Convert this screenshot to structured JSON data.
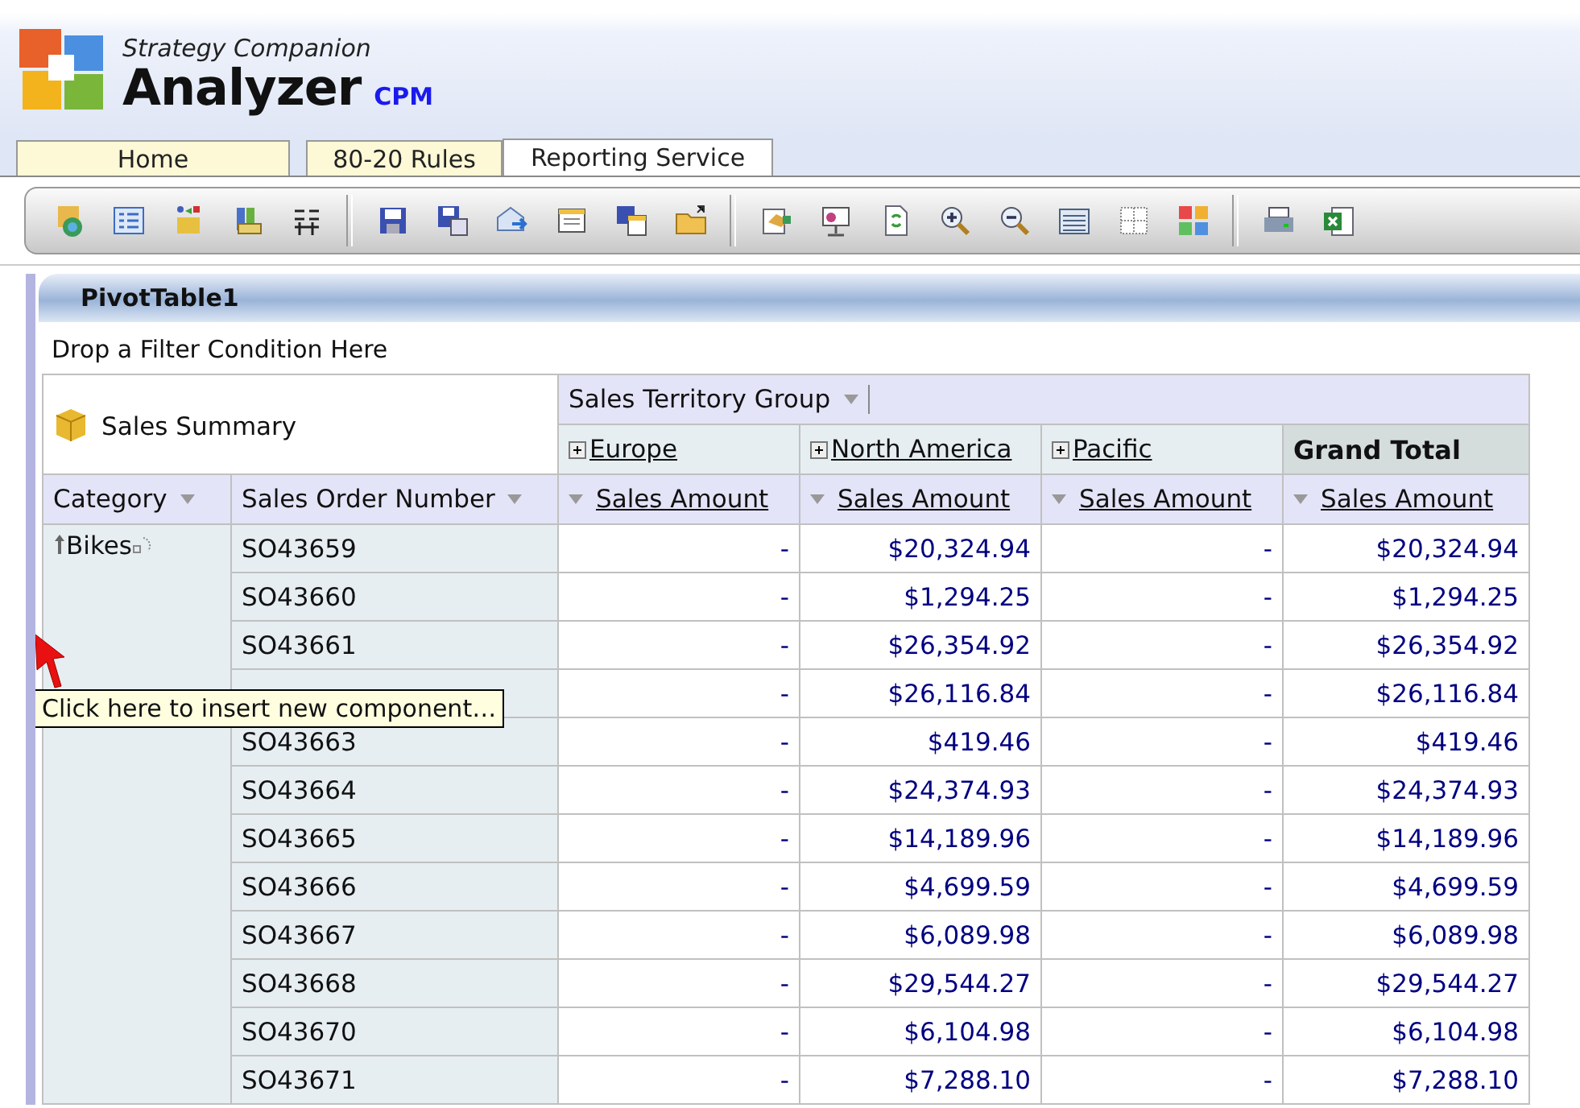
{
  "app": {
    "brand": "Strategy Companion",
    "name": "Analyzer",
    "edition": "CPM"
  },
  "tabs": [
    {
      "label": "Home",
      "selected": false
    },
    {
      "label": "80-20 Rules",
      "selected": false
    },
    {
      "label": "Reporting Service",
      "selected": true
    }
  ],
  "panel": {
    "title": "PivotTable1",
    "filter_hint": "Drop a Filter Condition Here"
  },
  "pivot": {
    "cube": "Sales Summary",
    "column_field": "Sales Territory Group",
    "row_fields": [
      "Category",
      "Sales Order Number"
    ],
    "members": [
      {
        "label": "Europe",
        "kind": "member"
      },
      {
        "label": "North America",
        "kind": "member"
      },
      {
        "label": "Pacific",
        "kind": "member"
      },
      {
        "label": "Grand Total",
        "kind": "total"
      }
    ],
    "measures": [
      "Sales Amount",
      "Sales Amount",
      "Sales Amount",
      "Sales Amount"
    ],
    "category": "Bikes",
    "rows": [
      {
        "order": "SO43659",
        "values": [
          "-",
          "$20,324.94",
          "-",
          "$20,324.94"
        ]
      },
      {
        "order": "SO43660",
        "values": [
          "-",
          "$1,294.25",
          "-",
          "$1,294.25"
        ]
      },
      {
        "order": "SO43661",
        "values": [
          "-",
          "$26,354.92",
          "-",
          "$26,354.92"
        ]
      },
      {
        "values": [
          "-",
          "$26,116.84",
          "-",
          "$26,116.84"
        ]
      },
      {
        "order": "SO43663",
        "values": [
          "-",
          "$419.46",
          "-",
          "$419.46"
        ]
      },
      {
        "order": "SO43664",
        "values": [
          "-",
          "$24,374.93",
          "-",
          "$24,374.93"
        ]
      },
      {
        "order": "SO43665",
        "values": [
          "-",
          "$14,189.96",
          "-",
          "$14,189.96"
        ]
      },
      {
        "order": "SO43666",
        "values": [
          "-",
          "$4,699.59",
          "-",
          "$4,699.59"
        ]
      },
      {
        "order": "SO43667",
        "values": [
          "-",
          "$6,089.98",
          "-",
          "$6,089.98"
        ]
      },
      {
        "order": "SO43668",
        "values": [
          "-",
          "$29,544.27",
          "-",
          "$29,544.27"
        ]
      },
      {
        "order": "SO43670",
        "values": [
          "-",
          "$6,104.98",
          "-",
          "$6,104.98"
        ]
      },
      {
        "order": "SO43671",
        "values": [
          "-",
          "$7,288.10",
          "-",
          "$7,288.10"
        ]
      }
    ]
  },
  "tooltip": "Click here to insert new component…"
}
